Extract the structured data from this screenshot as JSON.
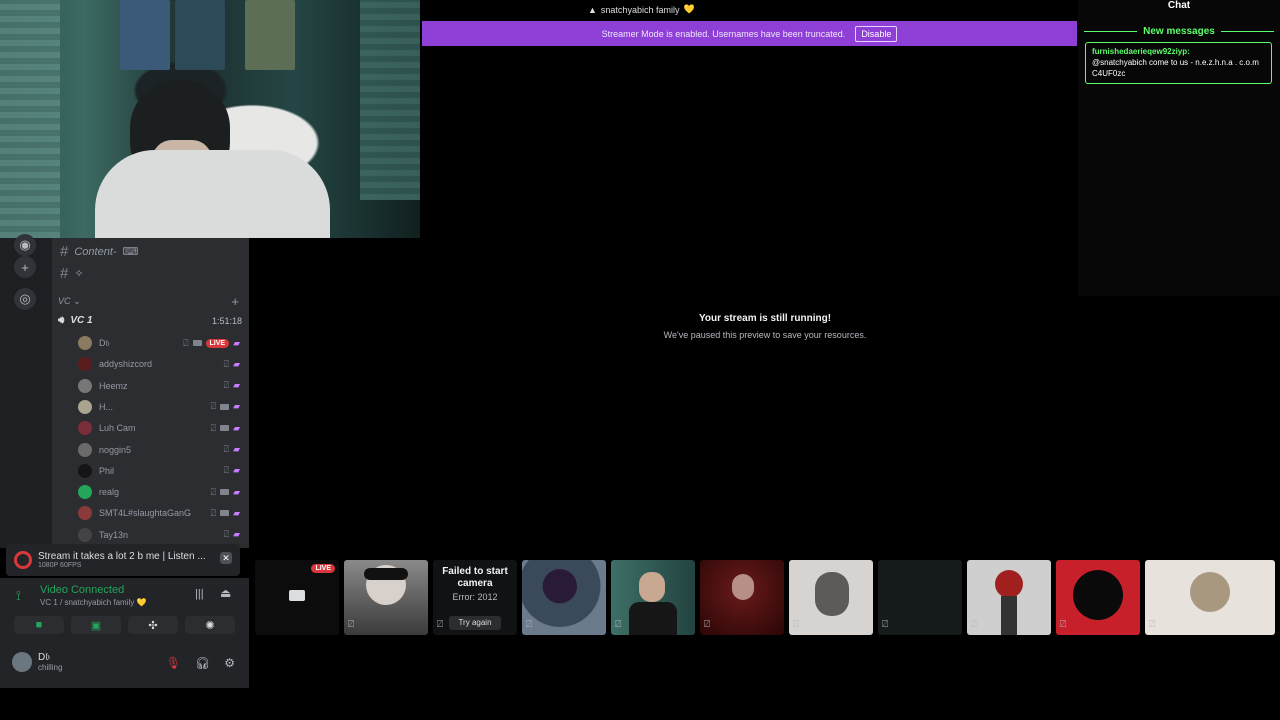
{
  "top_user": {
    "name": "snatchyabich family",
    "heart": "💛"
  },
  "banner": {
    "text": "Streamer Mode is enabled. Usernames have been truncated.",
    "button": "Disable"
  },
  "stream": {
    "title": "Your stream is still running!",
    "subtitle": "We've paused this preview to save your resources."
  },
  "chat": {
    "title": "Chat",
    "new_messages": "New messages",
    "message": {
      "user": "furnishedaerieqew92ziyp",
      "text": "@snatchyabich come to us - n.e.z.h.n.a . c.o.m C4UF0zc"
    }
  },
  "channels": {
    "content": "Content-",
    "content_icon": "keyboard-icon",
    "hash2_icon": "sparkle-icon",
    "category": "VC",
    "voice_channel": {
      "name": "VC 1",
      "time": "1:51:18"
    },
    "members": [
      {
        "name": "D𝔟",
        "live": "LIVE",
        "color": "#8a7a60"
      },
      {
        "name": "addyshizcord",
        "color": "#5a1d1d"
      },
      {
        "name": "Heemz",
        "color": "#777"
      },
      {
        "name": "H...",
        "color": "#a9a390"
      },
      {
        "name": "Luh Cam",
        "color": "#7a2e3a"
      },
      {
        "name": "noggin5",
        "color": "#6a6a6a"
      },
      {
        "name": "Phil",
        "color": "#151515"
      },
      {
        "name": "realg",
        "color": "#23a55a"
      },
      {
        "name": "SMT4L#slaughtaGanG",
        "color": "#8a3a3a"
      },
      {
        "name": "Tay13n",
        "color": "#444"
      }
    ]
  },
  "stream_bar": {
    "title": "Stream it takes a lot 2 b me | Listen ...",
    "quality": "1080P 60FPS"
  },
  "voice": {
    "status": "Video Connected",
    "channel": "VC 1 / snatchyabich family 💛"
  },
  "user": {
    "name": "D𝔟",
    "status": "chilling"
  },
  "tiles": {
    "live": "LIVE",
    "fail_title": "Failed to start camera",
    "fail_error": "Error: 2012",
    "fail_button": "Try again"
  },
  "colors": {
    "banner": "#8e3fd6",
    "chat_accent": "#5cff6a",
    "live": "#da373c",
    "connected": "#23a55a"
  }
}
